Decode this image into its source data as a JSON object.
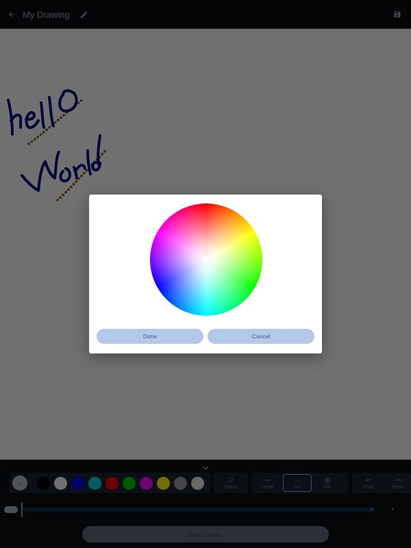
{
  "appbar": {
    "title": "My Drawing",
    "back_icon": "arrow-back-icon",
    "edit_icon": "pencil-icon",
    "save_icon": "save-icon"
  },
  "canvas": {
    "strokes": [
      {
        "text": "hello",
        "color": "#0e0e8c"
      },
      {
        "text": "World",
        "color": "#0e0e8c"
      }
    ],
    "dot_color": "#8a6a1f"
  },
  "palette": {
    "auto_icon": "auto-color-icon",
    "colors": [
      "#000000",
      "#ffffff",
      "#0000ff",
      "#00d5d5",
      "#ff0000",
      "#00cc00",
      "#ff00ff",
      "#ffff00",
      "#9e9e9e",
      "#eeeeee"
    ]
  },
  "tools": {
    "erase": "Erase",
    "stroke": "Stroke",
    "dot": "Dot",
    "fill": "Fill",
    "undo": "Undo",
    "redo": "Redo"
  },
  "slider": {
    "value": 0.0
  },
  "bottom": {
    "clear_label": "Clear Canvas"
  },
  "dialog": {
    "done_label": "Done",
    "cancel_label": "Cancel"
  },
  "colors": {
    "accent": "#b4c8ea",
    "scrim": "rgba(0,0,0,0.56)",
    "bar": "#0b0d10"
  }
}
